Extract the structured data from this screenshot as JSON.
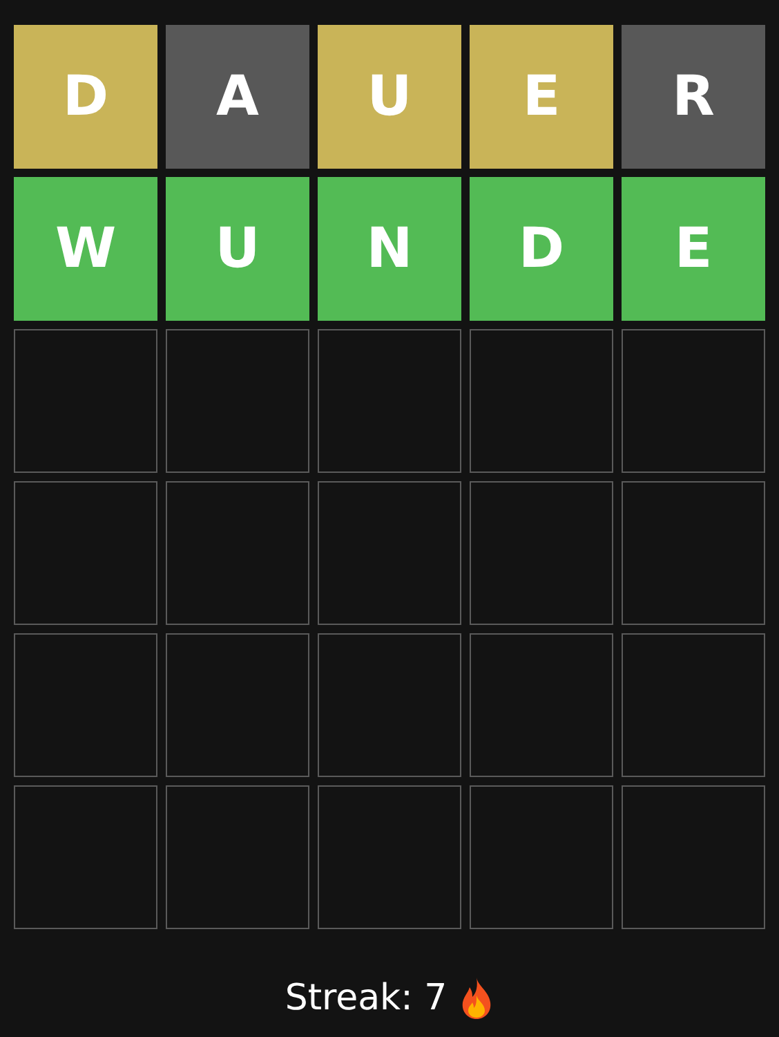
{
  "board": [
    {
      "tiles": [
        {
          "letter": "D",
          "kind": "present"
        },
        {
          "letter": "A",
          "kind": "absent"
        },
        {
          "letter": "U",
          "kind": "present"
        },
        {
          "letter": "E",
          "kind": "present"
        },
        {
          "letter": "R",
          "kind": "absent"
        }
      ]
    },
    {
      "tiles": [
        {
          "letter": "W",
          "kind": "correct"
        },
        {
          "letter": "U",
          "kind": "correct"
        },
        {
          "letter": "N",
          "kind": "correct"
        },
        {
          "letter": "D",
          "kind": "correct"
        },
        {
          "letter": "E",
          "kind": "correct"
        }
      ]
    },
    {
      "tiles": [
        {
          "kind": "empty"
        },
        {
          "kind": "empty"
        },
        {
          "kind": "empty"
        },
        {
          "kind": "empty"
        },
        {
          "kind": "empty"
        }
      ]
    },
    {
      "tiles": [
        {
          "kind": "empty"
        },
        {
          "kind": "empty"
        },
        {
          "kind": "empty"
        },
        {
          "kind": "empty"
        },
        {
          "kind": "empty"
        }
      ]
    },
    {
      "tiles": [
        {
          "kind": "empty"
        },
        {
          "kind": "empty"
        },
        {
          "kind": "empty"
        },
        {
          "kind": "empty"
        },
        {
          "kind": "empty"
        }
      ]
    },
    {
      "tiles": [
        {
          "kind": "empty"
        },
        {
          "kind": "empty"
        },
        {
          "kind": "empty"
        },
        {
          "kind": "empty"
        },
        {
          "kind": "empty"
        }
      ]
    }
  ],
  "streak": {
    "label": "Streak: 7"
  }
}
